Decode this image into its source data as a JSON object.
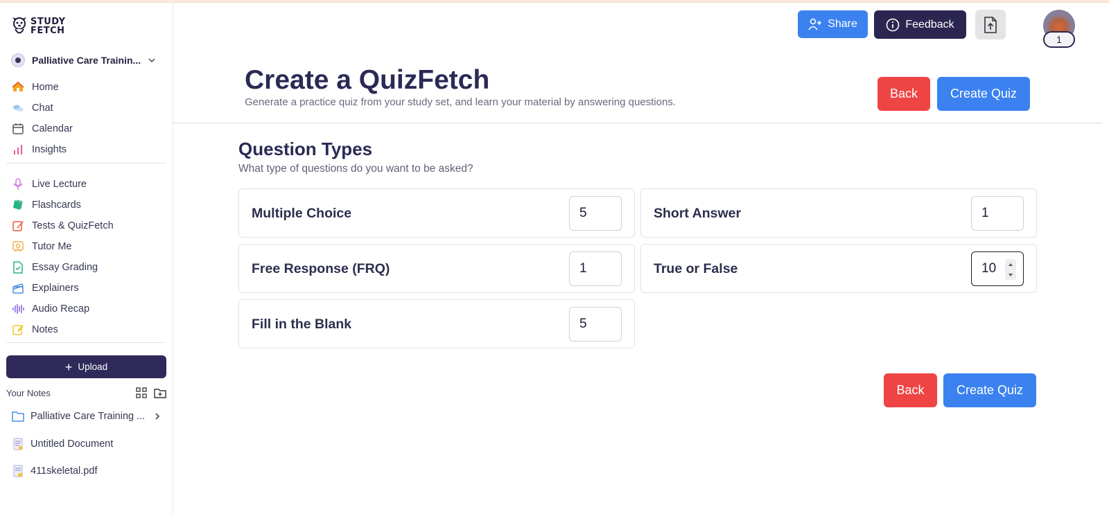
{
  "app": {
    "logo_line1": "STUDY",
    "logo_line2": "FETCH"
  },
  "sidebar": {
    "study_set": "Palliative Care Trainin...",
    "nav_group1": [
      {
        "label": "Home",
        "icon": "home-icon"
      },
      {
        "label": "Chat",
        "icon": "chat-icon"
      },
      {
        "label": "Calendar",
        "icon": "calendar-icon"
      },
      {
        "label": "Insights",
        "icon": "insights-icon"
      }
    ],
    "nav_group2": [
      {
        "label": "Live Lecture",
        "icon": "microphone-icon"
      },
      {
        "label": "Flashcards",
        "icon": "flashcards-icon"
      },
      {
        "label": "Tests & QuizFetch",
        "icon": "pencil-icon"
      },
      {
        "label": "Tutor Me",
        "icon": "tutor-icon"
      },
      {
        "label": "Essay Grading",
        "icon": "essay-check-icon"
      },
      {
        "label": "Explainers",
        "icon": "clapperboard-icon"
      },
      {
        "label": "Audio Recap",
        "icon": "audio-wave-icon"
      },
      {
        "label": "Notes",
        "icon": "notes-icon"
      }
    ],
    "upload_label": "Upload",
    "your_notes_label": "Your Notes",
    "notes": [
      {
        "label": "Palliative Care Training ...",
        "icon": "folder-icon"
      },
      {
        "label": "Untitled Document",
        "icon": "document-icon"
      },
      {
        "label": "411skeletal.pdf",
        "icon": "pdf-icon"
      }
    ]
  },
  "header": {
    "share_label": "Share",
    "feedback_label": "Feedback",
    "avatar_badge": "1"
  },
  "main": {
    "title": "Create a QuizFetch",
    "subtitle": "Generate a practice quiz from your study set, and learn your material by answering questions.",
    "back_label": "Back",
    "create_label": "Create Quiz",
    "section_title": "Question Types",
    "section_subtitle": "What type of questions do you want to be asked?",
    "question_types": [
      {
        "label": "Multiple Choice",
        "value": "5"
      },
      {
        "label": "Short Answer",
        "value": "1"
      },
      {
        "label": "Free Response (FRQ)",
        "value": "1"
      },
      {
        "label": "True or False",
        "value": "10"
      },
      {
        "label": "Fill in the Blank",
        "value": "5"
      }
    ]
  },
  "colors": {
    "primary_blue": "#3b82f0",
    "dark_purple": "#2b2650",
    "danger_red": "#ef4444"
  }
}
